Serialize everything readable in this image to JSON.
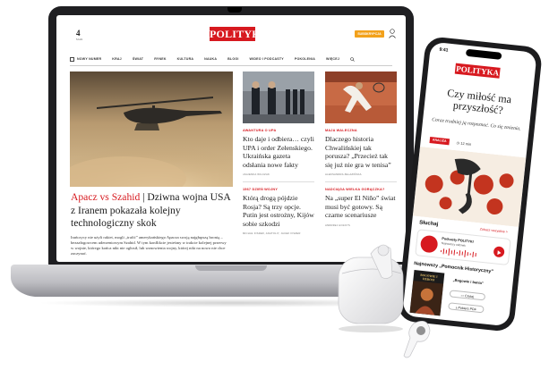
{
  "laptop": {
    "date": {
      "day": "4",
      "month": "MAR"
    },
    "logo": "POLITYKA",
    "subscribe_label": "SUBSKRYPCJA",
    "nav": [
      "NOWY NUMER",
      "KRAJ",
      "ŚWIAT",
      "RYNEK",
      "KULTURA",
      "NAUKA",
      "BLOGI",
      "WIDEO I PODCASTY",
      "POKOLENIA",
      "WIĘCEJ"
    ],
    "hero": {
      "kicker": "Apacz vs Szahid",
      "separator": " | ",
      "headline": "Dziwna wojna USA z Iranem pokazała kolejny technologiczny skok",
      "lead": "Irańczycy nie użyli rakiet, mogli „trafić” amerykańskiego Apacza swoją najgłupszą bronią – bezzałogowcem uderzeniowym Szahid. W tym konflikcie jesteśmy w trakcie kolejnej przerwy w wojnie, którego końca nikt nie ogłosił, lub wznowienia wojny, której nikt na nowo nie chce zaczynać."
    },
    "col2": {
      "label1": "AWANTURA O UPA",
      "title1": "Kto daje i odbiera… czyli UPA i order Zełenskiego. Ukraińska gazeta odsłania nowe fakty",
      "author1": "JAGIENKA WILCZAK",
      "label2": "1567 DZIEŃ WOJNY",
      "title2": "Którą drogą pójdzie Rosja? Są trzy opcje. Putin jest ostrożny, Kijów sobie szkodzi",
      "author2": "MICHAŁ FISZER, ANATOLIY, JACEK FISZER"
    },
    "col3": {
      "label1": "MAJA WALECZNA",
      "title1": "Dlaczego historia Chwalińskiej tak porusza? „Przecież tak się już nie gra w tenisa”",
      "author1": "ALEKSANDRA ŻELAZIŃSKA",
      "label2": "NADCIĄGA WIELKA GORĄCZKA?",
      "title2": "Na „super El Niño” świat musi być gotowy. Są czarne scenariusze",
      "author2": "ANDRZEJ HOŁDYS"
    }
  },
  "phone": {
    "time": "9:41",
    "logo": "POLITYKA",
    "headline": "Czy miłość ma przyszłość?",
    "subtitle": "Coraz trudniej ją rozpoznać. Co się zmienia.",
    "tag": "ANALIZA",
    "read_time": "12 min",
    "listen_title": "Słuchaj",
    "listen_link": "Zobacz wszystkie >",
    "podcast_name": "Podcasty POLITYKI",
    "podcast_sub": "Najnowszy odcinek",
    "magazine_title": "Najnowszy „Pomocnik Historyczny”",
    "magazine_quote": "„Bogowie i bania”",
    "cover_title": "BOGOWIE I HEROSI",
    "read_btn": "Czytaj",
    "pdf_btn": "Pobierz PDF"
  },
  "colors": {
    "brand_red": "#d7191f",
    "subscribe_orange": "#f2a11b"
  }
}
